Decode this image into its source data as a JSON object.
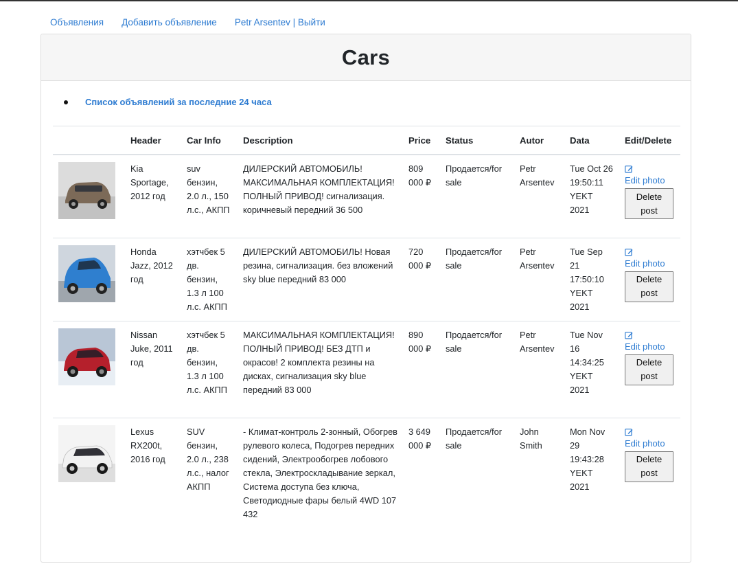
{
  "nav": {
    "items": [
      {
        "label": "Объявления"
      },
      {
        "label": "Добавить объявление"
      },
      {
        "label": "Petr Arsentev | Выйти"
      }
    ]
  },
  "page": {
    "title": "Cars",
    "recent_link": "Список объявлений за последние 24 часа"
  },
  "table": {
    "headers": [
      "",
      "Header",
      "Car Info",
      "Description",
      "Price",
      "Status",
      "Autor",
      "Data",
      "Edit/Delete"
    ],
    "rows": [
      {
        "image_icon": "brown-suv-photo",
        "header": "Kia Sportage, 2012 год",
        "car_info": "suv бензин, 2.0 л., 150 л.с., АКПП",
        "description": "ДИЛЕРСКИЙ АВТОМОБИЛЬ! МАКСИМАЛЬНАЯ КОМПЛЕКТАЦИЯ! ПОЛНЫЙ ПРИВОД! сигнализация. коричневый передний 36 500",
        "price": "809 000 ₽",
        "status": "Продается/for sale",
        "autor": "Petr Arsentev",
        "date": "Tue Oct 26 19:50:11 YEKT 2021",
        "edit_label": "Edit photo",
        "delete_label": "Delete post",
        "car_color": "#7c6a58"
      },
      {
        "image_icon": "blue-hatchback-photo",
        "header": "Honda Jazz, 2012 год",
        "car_info": "хэтчбек 5 дв. бензин, 1.3 л 100 л.с. АКПП",
        "description": "ДИЛЕРСКИЙ АВТОМОБИЛЬ! Новая резина, сигнализация. без вложений sky blue передний 83 000",
        "price": "720 000 ₽",
        "status": "Продается/for sale",
        "autor": "Petr Arsentev",
        "date": "Tue Sep 21 17:50:10 YEKT 2021",
        "edit_label": "Edit photo",
        "delete_label": "Delete post",
        "car_color": "#2f7fcf"
      },
      {
        "image_icon": "red-crossover-photo",
        "header": "Nissan Juke, 2011 год",
        "car_info": "хэтчбек 5 дв. бензин, 1.3 л 100 л.с. АКПП",
        "description": "МАКСИМАЛЬНАЯ КОМПЛЕКТАЦИЯ! ПОЛНЫЙ ПРИВОД! БЕЗ ДТП и окрасов! 2 комплекта резины на дисках, сигнализация sky blue передний 83 000",
        "price": "890 000 ₽",
        "status": "Продается/for sale",
        "autor": "Petr Arsentev",
        "date": "Tue Nov 16 14:34:25 YEKT 2021",
        "edit_label": "Edit photo",
        "delete_label": "Delete post",
        "car_color": "#b5202c"
      },
      {
        "image_icon": "white-suv-photo",
        "header": "Lexus RX200t, 2016 год",
        "car_info": "SUV бензин, 2.0 л., 238 л.с., налог АКПП",
        "description": "- Климат-контроль 2-зонный, Обогрев рулевого колеса, Подогрев передних сидений, Электрообогрев лобового стекла, Электроскладывание зеркал, Система доступа без ключа, Светодиодные фары белый 4WD 107 432",
        "price": "3 649 000 ₽",
        "status": "Продается/for sale",
        "autor": "John Smith",
        "date": "Mon Nov 29 19:43:28 YEKT 2021",
        "edit_label": "Edit photo",
        "delete_label": "Delete post",
        "car_color": "#f2f2f2"
      }
    ]
  },
  "colors": {
    "link": "#2d7bd1",
    "header_bg": "#f6f6f6",
    "border": "#dee2e6"
  }
}
